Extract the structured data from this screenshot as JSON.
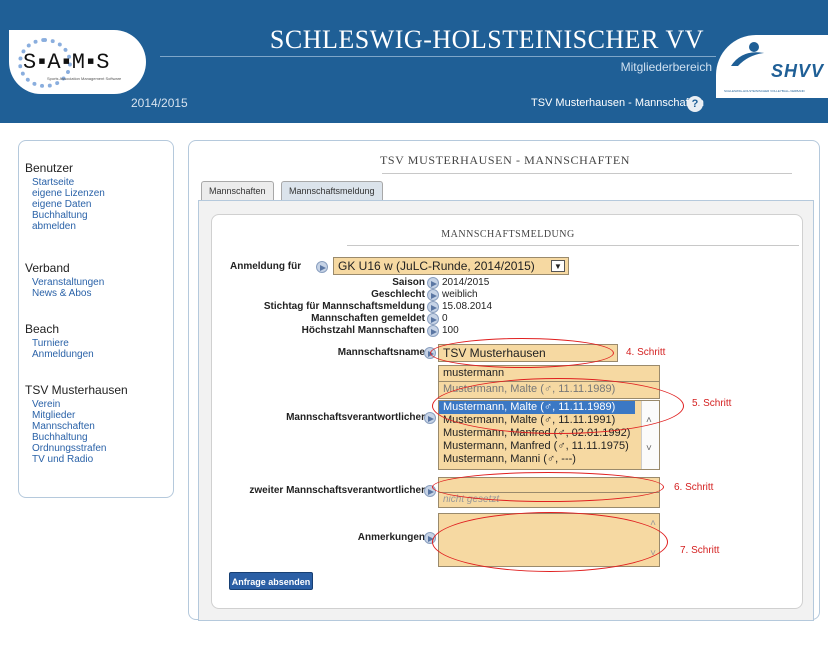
{
  "header": {
    "logo_text": "S▪A▪M▪S",
    "logo_subtitle": "Sports Association Management Software",
    "season": "2014/2015",
    "association_title": "SCHLESWIG-HOLSTEINISCHER VV",
    "area_label": "Mitgliederbereich",
    "team_title": "TSV Musterhausen - Mannschaften",
    "help_icon": "?",
    "shvv_logo_text": "SHVV",
    "shvv_logo_sub": "SCHLESWIG-HOLSTEINISCHER VOLLEYBALL-VERBAND"
  },
  "sidebar": {
    "groups": [
      {
        "title": "Benutzer",
        "items": [
          "Startseite",
          "eigene Lizenzen",
          "eigene Daten",
          "Buchhaltung",
          "abmelden"
        ]
      },
      {
        "title": "Verband",
        "items": [
          "Veranstaltungen",
          "News & Abos"
        ]
      },
      {
        "title": "Beach",
        "items": [
          "Turniere",
          "Anmeldungen"
        ]
      },
      {
        "title": "TSV Musterhausen",
        "items": [
          "Verein",
          "Mitglieder",
          "Mannschaften",
          "Buchhaltung",
          "Ordnungsstrafen",
          "TV und Radio"
        ]
      }
    ]
  },
  "panel": {
    "title": "TSV MUSTERHAUSEN - MANNSCHAFTEN",
    "tabs": [
      {
        "label": "Mannschaften"
      },
      {
        "label": "Mannschaftsmeldung"
      }
    ],
    "form_title": "MANNSCHAFTSMELDUNG"
  },
  "form": {
    "anmeldung_label": "Anmeldung für",
    "anmeldung_value": "GK U16 w (JuLC-Runde, 2014/2015)",
    "rows": [
      {
        "label": "Saison",
        "value": "2014/2015"
      },
      {
        "label": "Geschlecht",
        "value": "weiblich"
      },
      {
        "label": "Stichtag für Mannschaftsmeldung",
        "value": "15.08.2014"
      },
      {
        "label": "Mannschaften gemeldet",
        "value": "0"
      },
      {
        "label": "Höchstzahl Mannschaften",
        "value": "100"
      }
    ],
    "team_name_label": "Mannschaftsname",
    "team_name_value": "TSV Musterhausen",
    "resp_label": "Mannschaftsverantwortlicher",
    "resp_search": "mustermann",
    "resp_selected": "Mustermann, Malte (♂, 11.11.1989)",
    "resp_options": [
      "Mustermann, Malte (♂, 11.11.1989)",
      "Mustermann, Malte (♂, 11.11.1991)",
      "Mustermann, Manfred (♂, 02.01.1992)",
      "Mustermann, Manfred (♂, 11.11.1975)",
      "Mustermann, Manni (♂, ---)"
    ],
    "second_resp_label": "zweiter Mannschaftsverantwortlicher",
    "second_resp_placeholder": "nicht gesetzt",
    "notes_label": "Anmerkungen",
    "submit_label": "Anfrage absenden"
  },
  "annotations": {
    "step4": "4. Schritt",
    "step5": "5. Schritt",
    "step6": "6. Schritt",
    "step7": "7. Schritt"
  },
  "colors": {
    "header_blue": "#1f5f96",
    "field_fill": "#f6d9a2",
    "selection_blue": "#3b78c4",
    "annotation_red": "#e02020"
  }
}
